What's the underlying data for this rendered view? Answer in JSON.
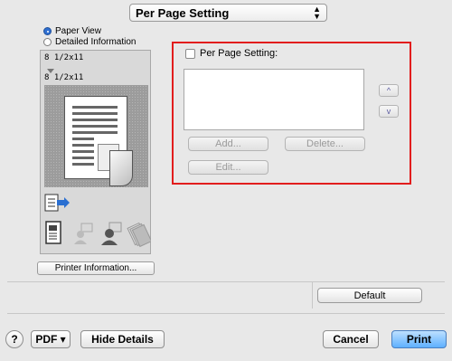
{
  "panel_popup": {
    "label": "Per Page Setting",
    "arrows": "▲\n▼"
  },
  "view_mode": {
    "options": [
      {
        "label": "Paper View",
        "selected": true
      },
      {
        "label": "Detailed Information",
        "selected": false
      }
    ]
  },
  "preview": {
    "input_paper": "8 1/2x11",
    "output_paper": "8 1/2x11"
  },
  "printer_info_label": "Printer Information...",
  "per_page": {
    "checkbox_label": "Per Page Setting:",
    "checked": false,
    "buttons": {
      "add": "Add...",
      "delete": "Delete...",
      "edit": "Edit..."
    },
    "move_up": "^",
    "move_down": "v"
  },
  "default_label": "Default",
  "footer": {
    "help": "?",
    "pdf": "PDF ▾",
    "hide_details": "Hide Details",
    "cancel": "Cancel",
    "print": "Print"
  },
  "colors": {
    "highlight_frame": "#e21d1d",
    "print_button": "#5fb0ff"
  }
}
